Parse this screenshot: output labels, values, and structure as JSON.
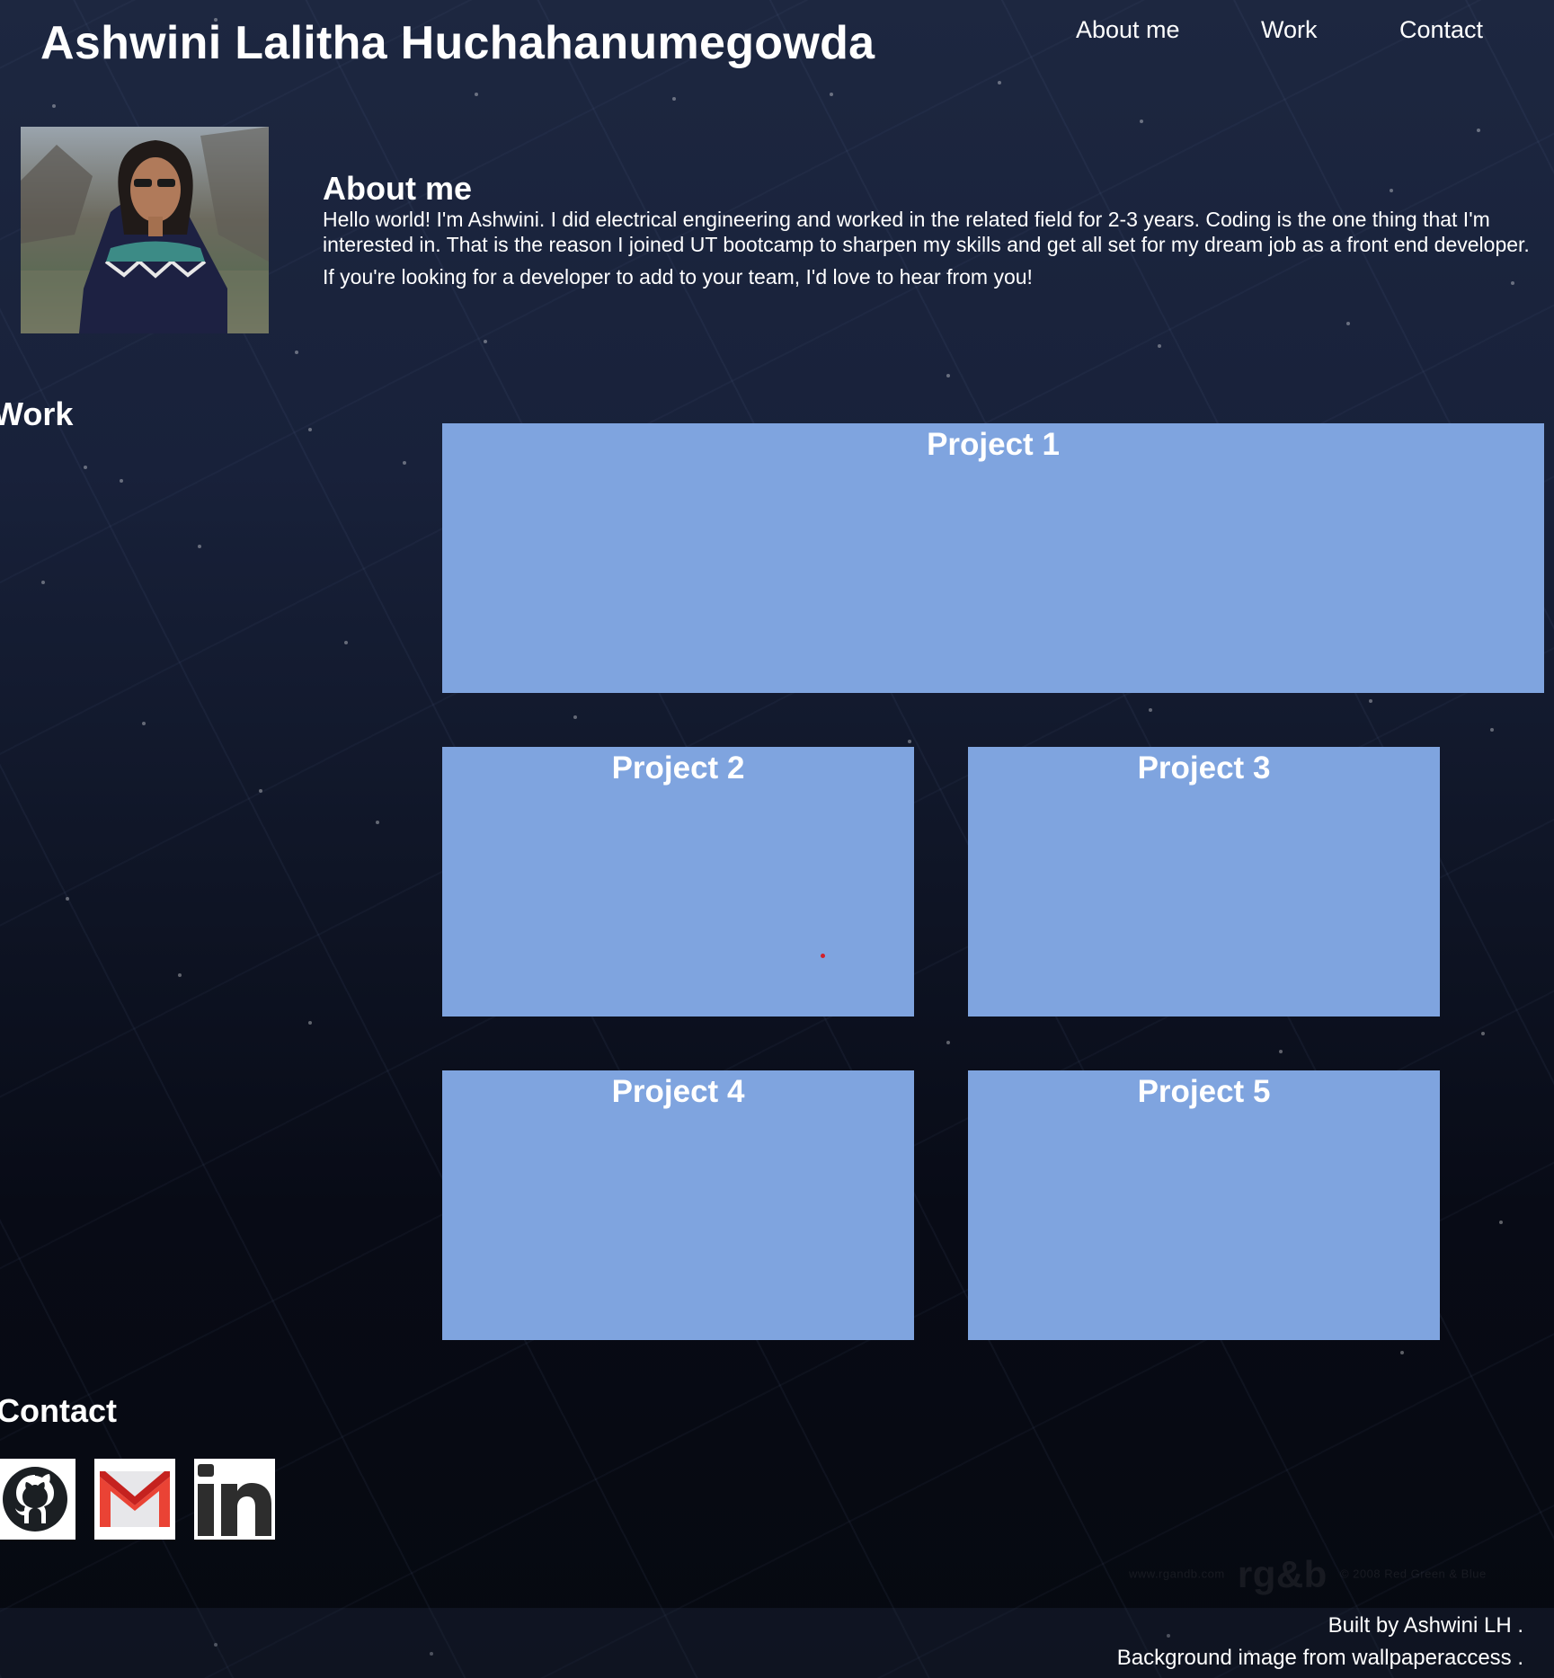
{
  "header": {
    "site_title": "Ashwini Lalitha Huchahanumegowda",
    "nav": {
      "about": "About me",
      "work": "Work",
      "contact": "Contact"
    }
  },
  "about": {
    "heading": "About me",
    "paragraphs": [
      "Hello world! I'm Ashwini. I did electrical engineering and worked in the related field for 2-3 years. Coding is the one thing that I'm interested in. That is the reason I joined UT bootcamp to sharpen my skills and get all set for my dream job as a front end developer.",
      "If you're looking for a developer to add to your team, I'd love to hear from you!"
    ]
  },
  "work": {
    "heading": "Work",
    "projects": [
      {
        "title": "Project 1"
      },
      {
        "title": "Project 2"
      },
      {
        "title": "Project 3"
      },
      {
        "title": "Project 4"
      },
      {
        "title": "Project 5"
      }
    ]
  },
  "contact": {
    "heading": "Contact",
    "icons": [
      "github-icon",
      "gmail-icon",
      "linkedin-icon"
    ],
    "linkedin_text": "in"
  },
  "watermark": {
    "left": "www.rgandb.com",
    "logo": "rg&b",
    "right": "© 2008 Red Green & Blue"
  },
  "footer": {
    "built_by": "Built by Ashwini LH .",
    "background_credit": "Background image from wallpaperaccess ."
  },
  "colors": {
    "project_card": "#7fa4df",
    "text": "#ffffff",
    "gmail_red": "#ea4335"
  }
}
